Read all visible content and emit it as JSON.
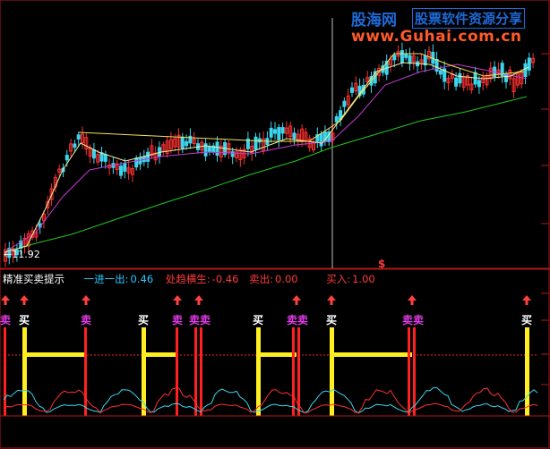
{
  "watermark": {
    "brand": "股海网",
    "tagline": "股票软件资源分享",
    "url": "www.Guhai.com.cn"
  },
  "price_panel": {
    "low_label": "11.92",
    "marker": "$"
  },
  "indicator": {
    "title": "精准买卖提示",
    "items": [
      {
        "label": "一进一出:",
        "value": "0.46",
        "color": "#27c9ff"
      },
      {
        "label": "处趋横生:",
        "value": "-0.46",
        "color": "#ff3a3a"
      },
      {
        "label": "卖出:",
        "value": "0.00",
        "color": "#ff3a3a"
      },
      {
        "label": "买入:",
        "value": "1.00",
        "color": "#ff3a3a"
      }
    ]
  },
  "signals": [
    {
      "type": "sell",
      "label": "卖"
    },
    {
      "type": "buy",
      "label": "买"
    },
    {
      "type": "sell",
      "label": "卖"
    },
    {
      "type": "buy",
      "label": "买"
    },
    {
      "type": "sell",
      "label": "卖"
    },
    {
      "type": "sell",
      "label": "卖卖"
    },
    {
      "type": "buy",
      "label": "买"
    },
    {
      "type": "sell",
      "label": "卖卖"
    },
    {
      "type": "buy",
      "label": "买"
    },
    {
      "type": "sell",
      "label": "卖卖"
    },
    {
      "type": "buy",
      "label": "买"
    }
  ],
  "colors": {
    "up": "#ff3030",
    "down": "#3ad6f0",
    "ma_long": "#22c522",
    "ma_mid": "#c43ad0",
    "ma_short": "#f0f0a0",
    "ma_yellow": "#f5e05a",
    "buy_bar": "#ffee22",
    "sell_bar": "#ff2020",
    "frame": "#b01818"
  }
}
